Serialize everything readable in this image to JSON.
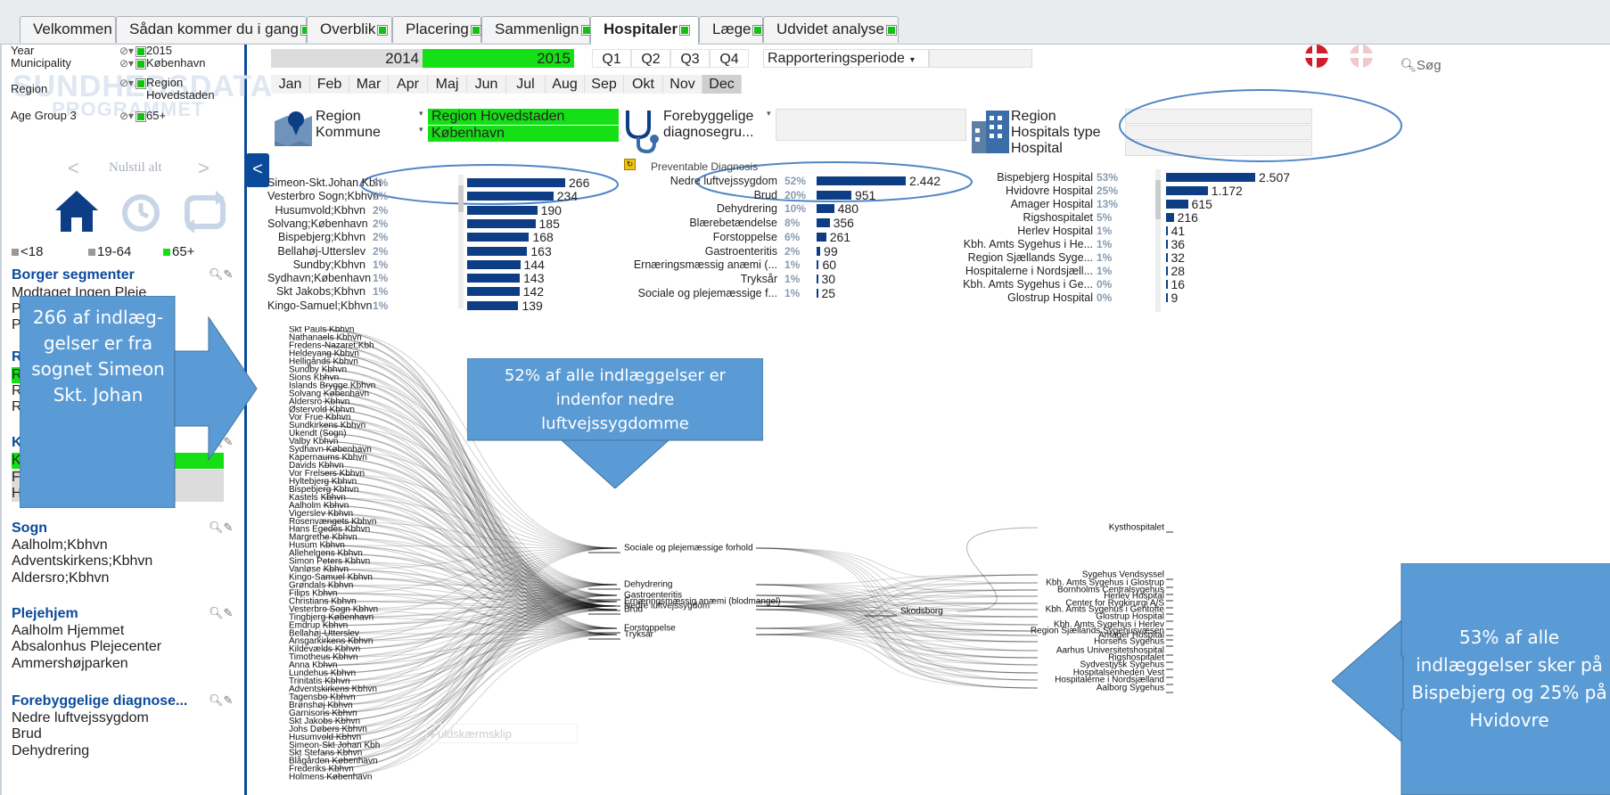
{
  "tabs": [
    {
      "label": "Velkommen",
      "dot": false
    },
    {
      "label": "Sådan kommer du i gang",
      "dot": true
    },
    {
      "label": "Overblik",
      "dot": true
    },
    {
      "label": "Placering",
      "dot": true
    },
    {
      "label": "Sammenlign",
      "dot": true
    },
    {
      "label": "Hospitaler",
      "dot": true
    },
    {
      "label": "Læge",
      "dot": true
    },
    {
      "label": "Udvidet analyse",
      "dot": true
    }
  ],
  "active_tab": "Hospitaler",
  "current_selections": [
    {
      "field": "Year",
      "value": "2015"
    },
    {
      "field": "Municipality",
      "value": "København"
    },
    {
      "field": "Region",
      "value": "Region Hovedstaden"
    },
    {
      "field": "Age Group 3",
      "value": "65+"
    }
  ],
  "watermark": {
    "line1": "SUNDHEDSDATA",
    "line2": "PROGRAMMET"
  },
  "nav": {
    "back": "<",
    "clear_all": "Nulstil alt",
    "forward": ">",
    "collapse": "<"
  },
  "age_groups": [
    "<18",
    "19-64",
    "65+"
  ],
  "years": {
    "y1": "2014",
    "y2": "2015"
  },
  "quarters": [
    "Q1",
    "Q2",
    "Q3",
    "Q4"
  ],
  "period_dropdown": "Rapporteringsperiode",
  "months": [
    "Jan",
    "Feb",
    "Mar",
    "Apr",
    "Maj",
    "Jun",
    "Jul",
    "Aug",
    "Sep",
    "Okt",
    "Nov",
    "Dec"
  ],
  "search_label": "Søg",
  "filters_left": {
    "region_label": "Region",
    "kommune_label": "Kommune",
    "region_value": "Region Hovedstaden",
    "kommune_value": "København"
  },
  "filters_mid": {
    "label_line1": "Forebyggelige",
    "label_line2": "diagnosegru..."
  },
  "filters_right": {
    "region": "Region",
    "hospitals_type": "Hospitals type",
    "hospital": "Hospital"
  },
  "left_panel": {
    "borger_title": "Borger segmenter",
    "borger_items": [
      "Modtaget Ingen Pleje",
      "P",
      "P"
    ],
    "region_first": "R",
    "region_items": [
      "R",
      "R",
      "R"
    ],
    "kommune_first": "K",
    "kommune_items": [
      "K",
      "F",
      "Halsnæs"
    ],
    "sogn_title": "Sogn",
    "sogn_items": [
      "Aalholm;Kbhvn",
      "Adventskirkens;Kbhvn",
      "Aldersro;Kbhvn"
    ],
    "plejehjem_title": "Plejehjem",
    "plejehjem_items": [
      "Aalholm Hjemmet",
      "Absalonhus Plejecenter",
      "Ammershøjparken"
    ],
    "forebyg_title": "Forebyggelige diagnose...",
    "forebyg_items": [
      "Nedre luftvejssygdom",
      "Brud",
      "Dehydrering"
    ]
  },
  "chart_data": [
    {
      "type": "bar",
      "title": "",
      "categories": [
        "Simeon-Skt.Johan.Kbh",
        "Vesterbro Sogn;Kbhvn",
        "Husumvold;Kbhvn",
        "Solvang;København",
        "Bispebjerg;Kbhvn",
        "Bellahøj-Utterslev",
        "Sundby;Kbhvn",
        "Sydhavn;København",
        "Skt Jakobs;Kbhvn",
        "Kingo-Samuel;Kbhvn"
      ],
      "percent": [
        "3%",
        "2%",
        "2%",
        "2%",
        "2%",
        "2%",
        "1%",
        "1%",
        "1%",
        "1%"
      ],
      "values": [
        266,
        234,
        190,
        185,
        168,
        163,
        144,
        143,
        142,
        139
      ],
      "labels": [
        "266",
        "234",
        "190",
        "185",
        "168",
        "163",
        "144",
        "143",
        "142",
        "139"
      ]
    },
    {
      "type": "bar",
      "title": "Preventable Diagnosis",
      "categories": [
        "Nedre luftvejssygdom",
        "Brud",
        "Dehydrering",
        "Blærebetændelse",
        "Forstoppelse",
        "Gastroenteritis",
        "Ernæringsmæssig anæmi (...",
        "Tryksår",
        "Sociale og plejemæssige f..."
      ],
      "percent": [
        "52%",
        "20%",
        "10%",
        "8%",
        "6%",
        "2%",
        "1%",
        "1%",
        "1%"
      ],
      "values": [
        2442,
        951,
        480,
        356,
        261,
        99,
        60,
        30,
        25
      ],
      "labels": [
        "2.442",
        "951",
        "480",
        "356",
        "261",
        "99",
        "60",
        "30",
        "25"
      ]
    },
    {
      "type": "bar",
      "title": "",
      "categories": [
        "Bispebjerg Hospital",
        "Hvidovre Hospital",
        "Amager Hospital",
        "Rigshospitalet",
        "Herlev Hospital",
        "Kbh. Amts Sygehus i He...",
        "Region Sjællands Syge...",
        "Hospitalerne i Nordsjæll...",
        "Kbh. Amts Sygehus i Ge...",
        "Glostrup Hospital"
      ],
      "percent": [
        "53%",
        "25%",
        "13%",
        "5%",
        "1%",
        "1%",
        "1%",
        "1%",
        "0%",
        "0%"
      ],
      "values": [
        2507,
        1172,
        615,
        216,
        41,
        36,
        32,
        28,
        16,
        9
      ],
      "labels": [
        "2.507",
        "1.172",
        "615",
        "216",
        "41",
        "36",
        "32",
        "28",
        "16",
        "9"
      ]
    }
  ],
  "sankey": {
    "left_labels": [
      "Skt Pauls Kbhvn",
      "Nathanaels Kbhvn",
      "Fredens-Nazaret;Kbh",
      "Heldevang Kbhvn",
      "Helligånds Kbhvn",
      "Sundby Kbhvn",
      "Sions Kbhvn",
      "Islands Brygge Kbhvn",
      "Solvang København",
      "Aldersro Kbhvn",
      "Østervold Kbhvn",
      "Vor Frue Kbhvn",
      "Sundkirkens Kbhvn",
      "Ukendt (Sogn)",
      "Valby Kbhvn",
      "Sydhavn København",
      "Kapernaums Kbhvn",
      "Davids Kbhvn",
      "Vor Frelsers Kbhvn",
      "Hyltebjerg Kbhvn",
      "Bispebjerg Kbhvn",
      "Kastels Kbhvn",
      "Aalholm Kbhvn",
      "Vigerslev Kbhvn",
      "Rosenvængets Kbhvn",
      "Hans Egedes Kbhvn",
      "Margrethe Kbhvn",
      "Husum Kbhvn",
      "Allehelgens Kbhvn",
      "Simon Peters Kbhvn",
      "Vanløse Kbhvn",
      "Kingo-Samuel Kbhvn",
      "Grøndals Kbhvn",
      "Filips Kbhvn",
      "Christians Kbhvn",
      "Vesterbro Sogn Kbhvn",
      "Tingbjerg København",
      "Emdrup Kbhvn",
      "Bellahøj-Utterslev",
      "Ansgarkirkens Kbhvn",
      "Kildevælds Kbhvn",
      "Timotheus Kbhvn",
      "Anna Kbhvn",
      "Lundehus Kbhvn",
      "Trinitatis Kbhvn",
      "Adventskirkens Kbhvn",
      "Tagensbo Kbhvn",
      "Brønshøj Kbhvn",
      "Garnisons Kbhvn",
      "Skt Jakobs Kbhvn",
      "Johs Døbers Kbhvn",
      "Husumvold Kbhvn",
      "Simeon-Skt Johan Kbh",
      "Skt Stefans Kbhvn",
      "Blågården København",
      "Frederiks Kbhvn",
      "Holmens København"
    ],
    "mid_labels": [
      "Sociale og plejemæssige forhold",
      "Dehydrering",
      "Gastroenteritis",
      "Ernæringsmæssig anæmi (blodmangel)",
      "Nedre luftvejssygdom",
      "Brud",
      "Forstoppelse",
      "Tryksår"
    ],
    "node_skodsborg": "Skodsborg",
    "right_labels": [
      "Kysthospitalet",
      "Sygehus Vendsyssel",
      "Kbh. Amts Sygehus i Glostrup",
      "Bornholms Centralsygehus",
      "Herlev Hospital",
      "Center for Rygkirurgi A/S",
      "Kbh. Amts Sygehus i Gentofte",
      "Glostrup Hospital",
      "Kbh. Amts Sygehus i Herlev",
      "Region Sjællands Sygehusvæsen",
      "Amager Hospital",
      "Horsens Sygehus",
      "Aarhus Universitetshospital",
      "Rigshospitalet",
      "Sydvestjysk Sygehus",
      "Hospitalsenheden Vest",
      "Hospitalerne i Nordsjælland",
      "Aalborg Sygehus"
    ],
    "fullscreen_hint": "Fuldskærmsklip"
  },
  "callouts": {
    "left": "266 af indlæg-gelser er fra sognet Simeon Skt. Johan",
    "middle": "52% af alle indlæggelser er indenfor nedre luftvejssygdomme",
    "right": "53% af alle indlæggelser sker på Bispebjerg og 25% på Hvidovre"
  },
  "colors": {
    "accent_green": "#15e015",
    "bar_blue": "#0d3e85",
    "callout_blue": "#5b9bd5",
    "header_blue": "#0b4a9a"
  }
}
